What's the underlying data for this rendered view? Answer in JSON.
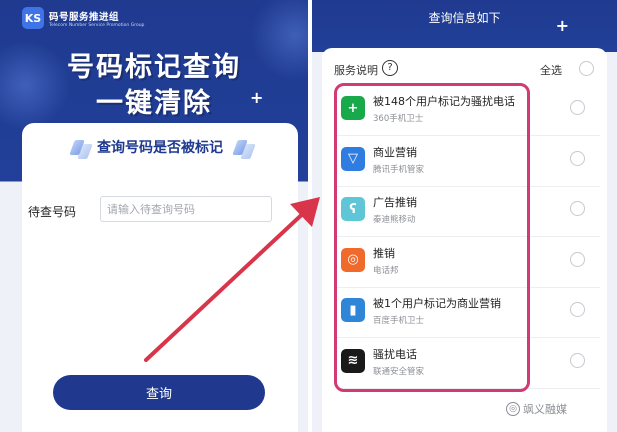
{
  "left_screen": {
    "brand": {
      "logo_text": "KS",
      "name": "码号服务推进组",
      "subtitle": "Telecom Number Service Promotion Group"
    },
    "hero_title_line1": "号码标记查询",
    "hero_title_line2": "一键清除",
    "card": {
      "title": "查询号码是否被标记",
      "field_label": "待查号码",
      "field_placeholder": "请输入待查询号码",
      "field_value": ""
    },
    "query_button_label": "查询"
  },
  "right_screen": {
    "header_title": "查询信息如下",
    "service_desc_label": "服务说明",
    "help_icon_glyph": "?",
    "select_all_label": "全选",
    "items": [
      {
        "title": "被148个用户标记为骚扰电话",
        "source": "360手机卫士",
        "icon": "360-security-icon",
        "icon_color": "#18a94b",
        "icon_glyph": "+"
      },
      {
        "title": "商业营销",
        "source": "腾讯手机管家",
        "icon": "tencent-shield-icon",
        "icon_color": "#2f7de1",
        "icon_glyph": "▽"
      },
      {
        "title": "广告推销",
        "source": "秦迪熊移动",
        "icon": "bear-icon",
        "icon_color": "#5ec6d6",
        "icon_glyph": "ʕ"
      },
      {
        "title": "推销",
        "source": "电话邦",
        "icon": "phone-bang-icon",
        "icon_color": "#f06a2b",
        "icon_glyph": "◎"
      },
      {
        "title": "被1个用户标记为商业营销",
        "source": "百度手机卫士",
        "icon": "baidu-guard-icon",
        "icon_color": "#2f86d8",
        "icon_glyph": "▮"
      },
      {
        "title": "骚扰电话",
        "source": "联通安全管家",
        "icon": "unicom-guard-icon",
        "icon_color": "#1a1a1a",
        "icon_glyph": "≋"
      }
    ]
  },
  "watermark": "飒义融媒",
  "colors": {
    "brand_navy": "#1f3a8f",
    "highlight_frame": "#d13a73",
    "arrow": "#d8354a"
  }
}
